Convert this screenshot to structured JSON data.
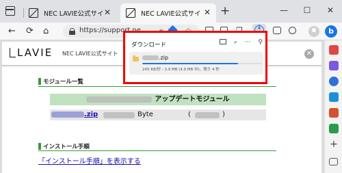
{
  "browser": {
    "tabs": [
      {
        "title": "NEC LAVIE公式サイト > サービス",
        "active": false
      },
      {
        "title": "NEC LAVIE公式サイト > サービス",
        "active": true
      }
    ],
    "new_tab": "+",
    "window_controls": {
      "minimize": "—",
      "maximize": "☐",
      "close": "✕"
    },
    "nav": {
      "back": "←",
      "refresh": "⟳",
      "home": "⌂"
    },
    "address": {
      "url": "https://support.ne..."
    },
    "toolbar_icons": {
      "read_aloud": "aあ",
      "favorites_add": "☆",
      "extensions": "⧉",
      "collections": "❐",
      "more": "…",
      "bing": "b"
    }
  },
  "download_panel": {
    "title": "ダウンロード",
    "tool_icons": [
      "folder-icon",
      "search-icon",
      "more-icon",
      "pin-icon"
    ],
    "item": {
      "name_suffix": ".zip",
      "status": "245 KB/秒 - 3.9 MB (4.9 MB 中)、残り 4 秒",
      "progress": 0.8
    }
  },
  "page": {
    "logo": "LAVIE",
    "site_name": "NEC LAVIE公式サイト",
    "close": "✕",
    "module_list_header": "モジュール一覧",
    "module_title_suffix": "アップデートモジュール",
    "zip_suffix": ".zip",
    "size_unit": "Byte",
    "paren_open": "(",
    "paren_close": ")",
    "install_header": "インストール手順",
    "install_link": "「インストール手順」を表示する"
  },
  "colors": {
    "highlight_border": "#ee0000",
    "accent": "#1a73e8",
    "section_green": "#3a9a3a"
  }
}
